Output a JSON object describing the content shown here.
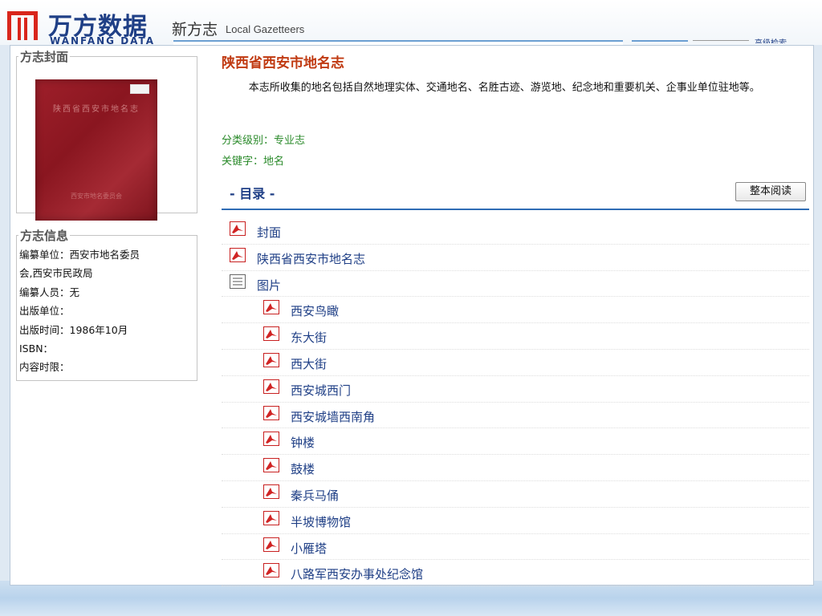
{
  "header": {
    "logo_cn": "万方数据",
    "logo_en": "WANFANG DATA",
    "brand_cn": "新方志",
    "brand_en": "Local Gazetteers",
    "advanced_link": "高级检索"
  },
  "cover": {
    "legend": "方志封面",
    "book_title": "陕西省西安市地名志",
    "book_publisher": "西安市地名委员会"
  },
  "info": {
    "legend": "方志信息",
    "lines": [
      "编纂单位：西安市地名委员",
      "会,西安市民政局",
      "编纂人员：无",
      "出版单位：",
      "出版时间：1986年10月",
      "ISBN：",
      "内容时限："
    ]
  },
  "doc": {
    "title": "陕西省西安市地名志",
    "description": "本志所收集的地名包括自然地理实体、交通地名、名胜古迹、游览地、纪念地和重要机关、企事业单位驻地等。",
    "category": "分类级别：专业志",
    "keywords": "关键字：地名"
  },
  "toc": {
    "title": "- 目录 -",
    "read_button": "整本阅读",
    "items": [
      {
        "label": "封面",
        "icon": "pdf-icon",
        "level": 0
      },
      {
        "label": "陕西省西安市地名志",
        "icon": "pdf-icon",
        "level": 0
      },
      {
        "label": "图片",
        "icon": "list-icon",
        "level": 0
      },
      {
        "label": "西安鸟瞰",
        "icon": "pdf-icon",
        "level": 1
      },
      {
        "label": "东大街",
        "icon": "pdf-icon",
        "level": 1
      },
      {
        "label": "西大街",
        "icon": "pdf-icon",
        "level": 1
      },
      {
        "label": "西安城西门",
        "icon": "pdf-icon",
        "level": 1
      },
      {
        "label": "西安城墙西南角",
        "icon": "pdf-icon",
        "level": 1
      },
      {
        "label": "钟楼",
        "icon": "pdf-icon",
        "level": 1
      },
      {
        "label": "鼓楼",
        "icon": "pdf-icon",
        "level": 1
      },
      {
        "label": "秦兵马俑",
        "icon": "pdf-icon",
        "level": 1
      },
      {
        "label": "半坡博物馆",
        "icon": "pdf-icon",
        "level": 1
      },
      {
        "label": "小雁塔",
        "icon": "pdf-icon",
        "level": 1
      },
      {
        "label": "八路军西安办事处纪念馆",
        "icon": "pdf-icon",
        "level": 1
      }
    ]
  },
  "colors": {
    "brand_blue": "#1f3f86",
    "title_red": "#c03a12",
    "meta_green": "#2a8a2a",
    "pdf_red": "#cc2222"
  }
}
